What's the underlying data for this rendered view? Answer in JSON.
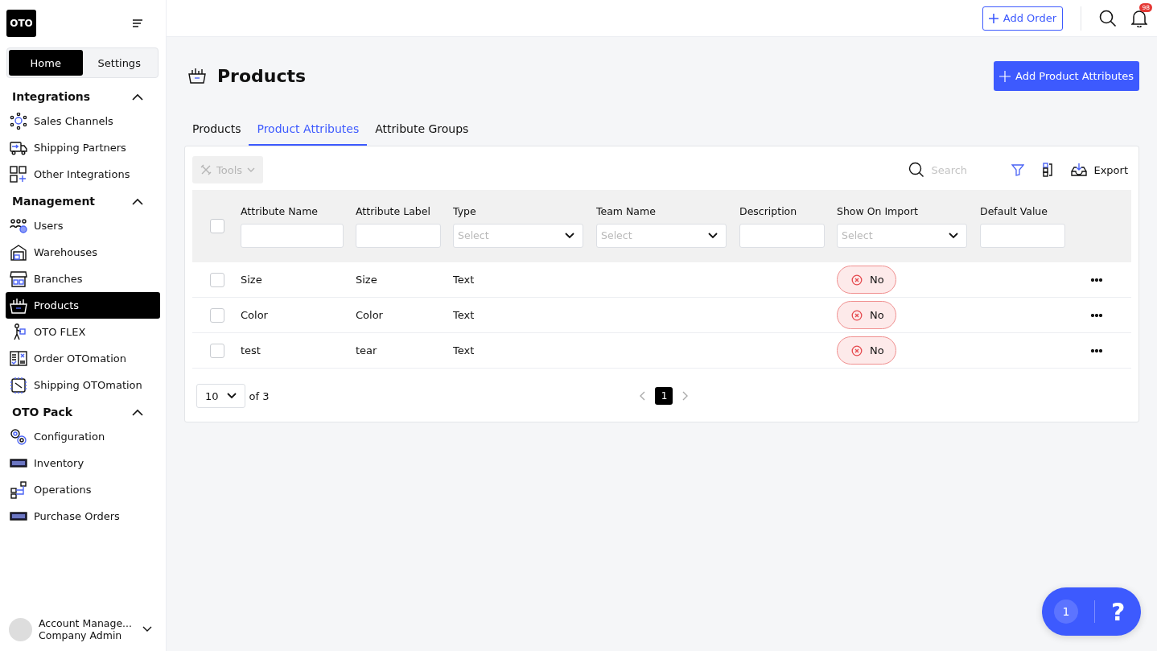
{
  "sidebar": {
    "logo": "OTO",
    "switch": [
      {
        "label": "Home",
        "selected": true
      },
      {
        "label": "Settings",
        "selected": false
      }
    ],
    "sections": [
      {
        "title": "Integrations",
        "expanded": true,
        "items": [
          {
            "label": "Sales Channels",
            "selected": false
          },
          {
            "label": "Shipping Partners",
            "selected": false
          },
          {
            "label": "Other Integrations",
            "selected": false
          }
        ]
      },
      {
        "title": "Management",
        "expanded": true,
        "items": [
          {
            "label": "Users",
            "selected": false
          },
          {
            "label": "Warehouses",
            "selected": false
          },
          {
            "label": "Branches",
            "selected": false
          },
          {
            "label": "Products",
            "selected": true
          },
          {
            "label": "OTO FLEX",
            "selected": false
          },
          {
            "label": "Order OTOmation",
            "selected": false
          },
          {
            "label": "Shipping OTOmation",
            "selected": false
          }
        ]
      },
      {
        "title": "OTO Pack",
        "expanded": true,
        "items": [
          {
            "label": "Configuration",
            "selected": false
          },
          {
            "label": "Inventory",
            "selected": false
          },
          {
            "label": "Operations",
            "selected": false
          },
          {
            "label": "Purchase Orders",
            "selected": false
          }
        ]
      }
    ],
    "account": {
      "name": "Account Manage...",
      "role": "Company Admin"
    }
  },
  "topbar": {
    "add_order": "Add Order",
    "notification_count": "98"
  },
  "page": {
    "title": "Products",
    "action": "Add Product Attributes",
    "tabs": [
      {
        "label": "Products",
        "selected": false
      },
      {
        "label": "Product Attributes",
        "selected": true
      },
      {
        "label": "Attribute Groups",
        "selected": false
      }
    ]
  },
  "toolbar": {
    "tools": "Tools",
    "tools_disabled": true,
    "search_placeholder": "Search",
    "export": "Export"
  },
  "table": {
    "columns": [
      {
        "label": "Attribute Name",
        "kind": "text"
      },
      {
        "label": "Attribute Label",
        "kind": "text"
      },
      {
        "label": "Type",
        "kind": "select",
        "placeholder": "Select"
      },
      {
        "label": "Team Name",
        "kind": "select",
        "placeholder": "Select"
      },
      {
        "label": "Description",
        "kind": "text"
      },
      {
        "label": "Show On Import",
        "kind": "select",
        "placeholder": "Select"
      },
      {
        "label": "Default Value",
        "kind": "text"
      }
    ],
    "rows": [
      {
        "checked": false,
        "attribute_name": "Size",
        "attribute_label": "Size",
        "type": "Text",
        "show_on_import": "No",
        "show_on_import_enabled": false
      },
      {
        "checked": false,
        "attribute_name": "Color",
        "attribute_label": "Color",
        "type": "Text",
        "show_on_import": "No",
        "show_on_import_enabled": false
      },
      {
        "checked": false,
        "attribute_name": "test",
        "attribute_label": "tear",
        "type": "Text",
        "show_on_import": "No",
        "show_on_import_enabled": false
      }
    ],
    "all_checked": false
  },
  "pagination": {
    "page_size": "10",
    "of": "of 3",
    "pages": [
      {
        "label": "1",
        "selected": true
      }
    ]
  },
  "help": {
    "count": "1",
    "label": "?"
  }
}
